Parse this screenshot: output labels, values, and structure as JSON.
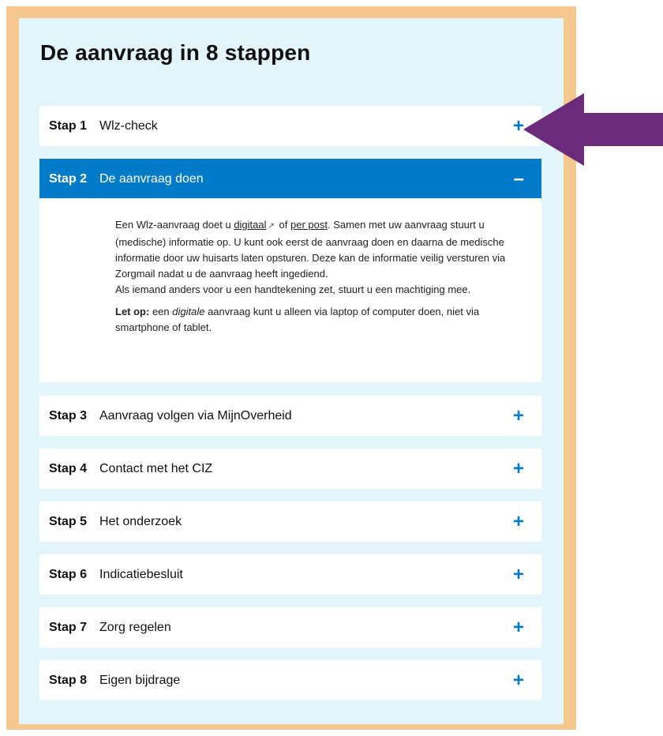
{
  "title": "De aanvraag in 8 stappen",
  "steps": [
    {
      "num": "Stap 1",
      "label": "Wlz-check",
      "toggle": "+"
    },
    {
      "num": "Stap 2",
      "label": "De aanvraag doen",
      "toggle": "–"
    },
    {
      "num": "Stap 3",
      "label": "Aanvraag volgen via MijnOverheid",
      "toggle": "+"
    },
    {
      "num": "Stap 4",
      "label": "Contact met het CIZ",
      "toggle": "+"
    },
    {
      "num": "Stap 5",
      "label": "Het onderzoek",
      "toggle": "+"
    },
    {
      "num": "Stap 6",
      "label": "Indicatiebesluit",
      "toggle": "+"
    },
    {
      "num": "Stap 7",
      "label": "Zorg regelen",
      "toggle": "+"
    },
    {
      "num": "Stap 8",
      "label": "Eigen bijdrage",
      "toggle": "+"
    }
  ],
  "expanded": {
    "p1_a": "Een Wlz-aanvraag doet u ",
    "link_digitaal": "digitaal",
    "ext_icon": "↗",
    "p1_b": " of ",
    "link_post": "per post",
    "p1_c": ". Samen met uw aanvraag stuurt u (medische) informatie op. U kunt ook eerst de aanvraag doen en daarna de medische informatie door uw huisarts laten opsturen. Deze kan de informatie veilig versturen via Zorgmail nadat u de aanvraag heeft ingediend.",
    "p1_d": "Als iemand anders voor u een handtekening zet, stuurt u een machtiging mee.",
    "note_bold": "Let op:",
    "note_a": " een ",
    "note_em": "digitale",
    "note_b": " aanvraag kunt u alleen via laptop of computer doen, niet via smartphone of tablet."
  },
  "colors": {
    "accent": "#007bc7",
    "panel": "#e3f4fb",
    "frame": "#f5c890",
    "arrow": "#6b2a7a"
  }
}
